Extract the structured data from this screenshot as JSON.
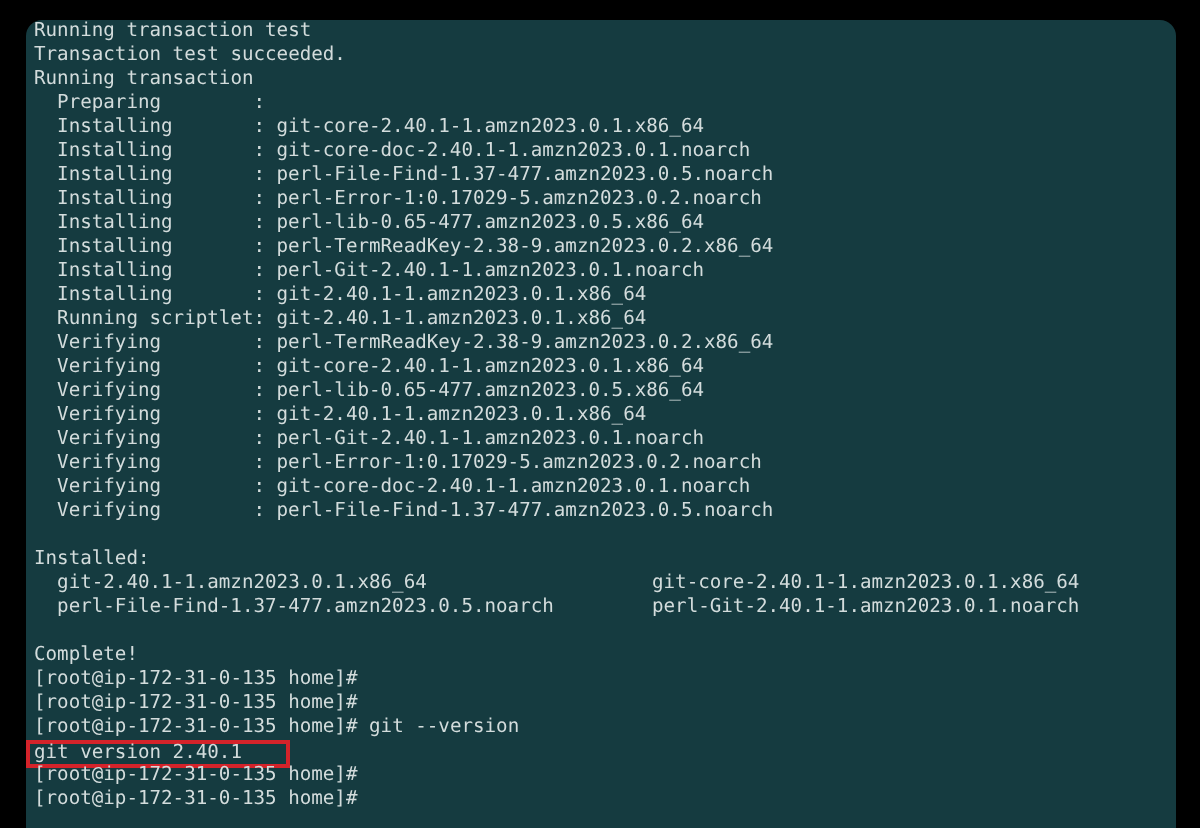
{
  "terminal": {
    "lines": [
      {
        "kind": "plain",
        "text": "Running transaction test",
        "highlighted": false
      },
      {
        "kind": "plain",
        "text": "Transaction test succeeded.",
        "highlighted": false
      },
      {
        "kind": "plain",
        "text": "Running transaction",
        "highlighted": false
      },
      {
        "kind": "step",
        "action": "Preparing",
        "detail": ":",
        "highlighted": false
      },
      {
        "kind": "step",
        "action": "Installing",
        "detail": ": git-core-2.40.1-1.amzn2023.0.1.x86_64",
        "highlighted": false
      },
      {
        "kind": "step",
        "action": "Installing",
        "detail": ": git-core-doc-2.40.1-1.amzn2023.0.1.noarch",
        "highlighted": false
      },
      {
        "kind": "step",
        "action": "Installing",
        "detail": ": perl-File-Find-1.37-477.amzn2023.0.5.noarch",
        "highlighted": false
      },
      {
        "kind": "step",
        "action": "Installing",
        "detail": ": perl-Error-1:0.17029-5.amzn2023.0.2.noarch",
        "highlighted": false
      },
      {
        "kind": "step",
        "action": "Installing",
        "detail": ": perl-lib-0.65-477.amzn2023.0.5.x86_64",
        "highlighted": false
      },
      {
        "kind": "step",
        "action": "Installing",
        "detail": ": perl-TermReadKey-2.38-9.amzn2023.0.2.x86_64",
        "highlighted": false
      },
      {
        "kind": "step",
        "action": "Installing",
        "detail": ": perl-Git-2.40.1-1.amzn2023.0.1.noarch",
        "highlighted": false
      },
      {
        "kind": "step",
        "action": "Installing",
        "detail": ": git-2.40.1-1.amzn2023.0.1.x86_64",
        "highlighted": false
      },
      {
        "kind": "step",
        "action": "Running scriptlet",
        "detail": ": git-2.40.1-1.amzn2023.0.1.x86_64",
        "highlighted": false
      },
      {
        "kind": "step",
        "action": "Verifying",
        "detail": ": perl-TermReadKey-2.38-9.amzn2023.0.2.x86_64",
        "highlighted": false
      },
      {
        "kind": "step",
        "action": "Verifying",
        "detail": ": git-core-2.40.1-1.amzn2023.0.1.x86_64",
        "highlighted": false
      },
      {
        "kind": "step",
        "action": "Verifying",
        "detail": ": perl-lib-0.65-477.amzn2023.0.5.x86_64",
        "highlighted": false
      },
      {
        "kind": "step",
        "action": "Verifying",
        "detail": ": git-2.40.1-1.amzn2023.0.1.x86_64",
        "highlighted": false
      },
      {
        "kind": "step",
        "action": "Verifying",
        "detail": ": perl-Git-2.40.1-1.amzn2023.0.1.noarch",
        "highlighted": false
      },
      {
        "kind": "step",
        "action": "Verifying",
        "detail": ": perl-Error-1:0.17029-5.amzn2023.0.2.noarch",
        "highlighted": false
      },
      {
        "kind": "step",
        "action": "Verifying",
        "detail": ": git-core-doc-2.40.1-1.amzn2023.0.1.noarch",
        "highlighted": false
      },
      {
        "kind": "step",
        "action": "Verifying",
        "detail": ": perl-File-Find-1.37-477.amzn2023.0.5.noarch",
        "highlighted": false
      },
      {
        "kind": "blank",
        "highlighted": false
      },
      {
        "kind": "plain",
        "text": "Installed:",
        "highlighted": false
      },
      {
        "kind": "pair",
        "items": [
          "git-2.40.1-1.amzn2023.0.1.x86_64",
          "git-core-2.40.1-1.amzn2023.0.1.x86_64"
        ],
        "highlighted": false
      },
      {
        "kind": "pair",
        "items": [
          "perl-File-Find-1.37-477.amzn2023.0.5.noarch",
          "perl-Git-2.40.1-1.amzn2023.0.1.noarch"
        ],
        "highlighted": false
      },
      {
        "kind": "blank",
        "highlighted": false
      },
      {
        "kind": "plain",
        "text": "Complete!",
        "highlighted": false
      },
      {
        "kind": "prompt",
        "prompt": "[root@ip-172-31-0-135 home]#",
        "highlighted": false
      },
      {
        "kind": "prompt",
        "prompt": "[root@ip-172-31-0-135 home]#",
        "highlighted": false
      },
      {
        "kind": "prompt",
        "prompt": "[root@ip-172-31-0-135 home]#",
        "command": "git --version",
        "highlighted": false
      },
      {
        "kind": "plain",
        "text": "git version 2.40.1",
        "highlighted": true
      },
      {
        "kind": "prompt",
        "prompt": "[root@ip-172-31-0-135 home]#",
        "highlighted": false
      },
      {
        "kind": "prompt",
        "prompt": "[root@ip-172-31-0-135 home]#",
        "highlighted": false
      }
    ]
  }
}
